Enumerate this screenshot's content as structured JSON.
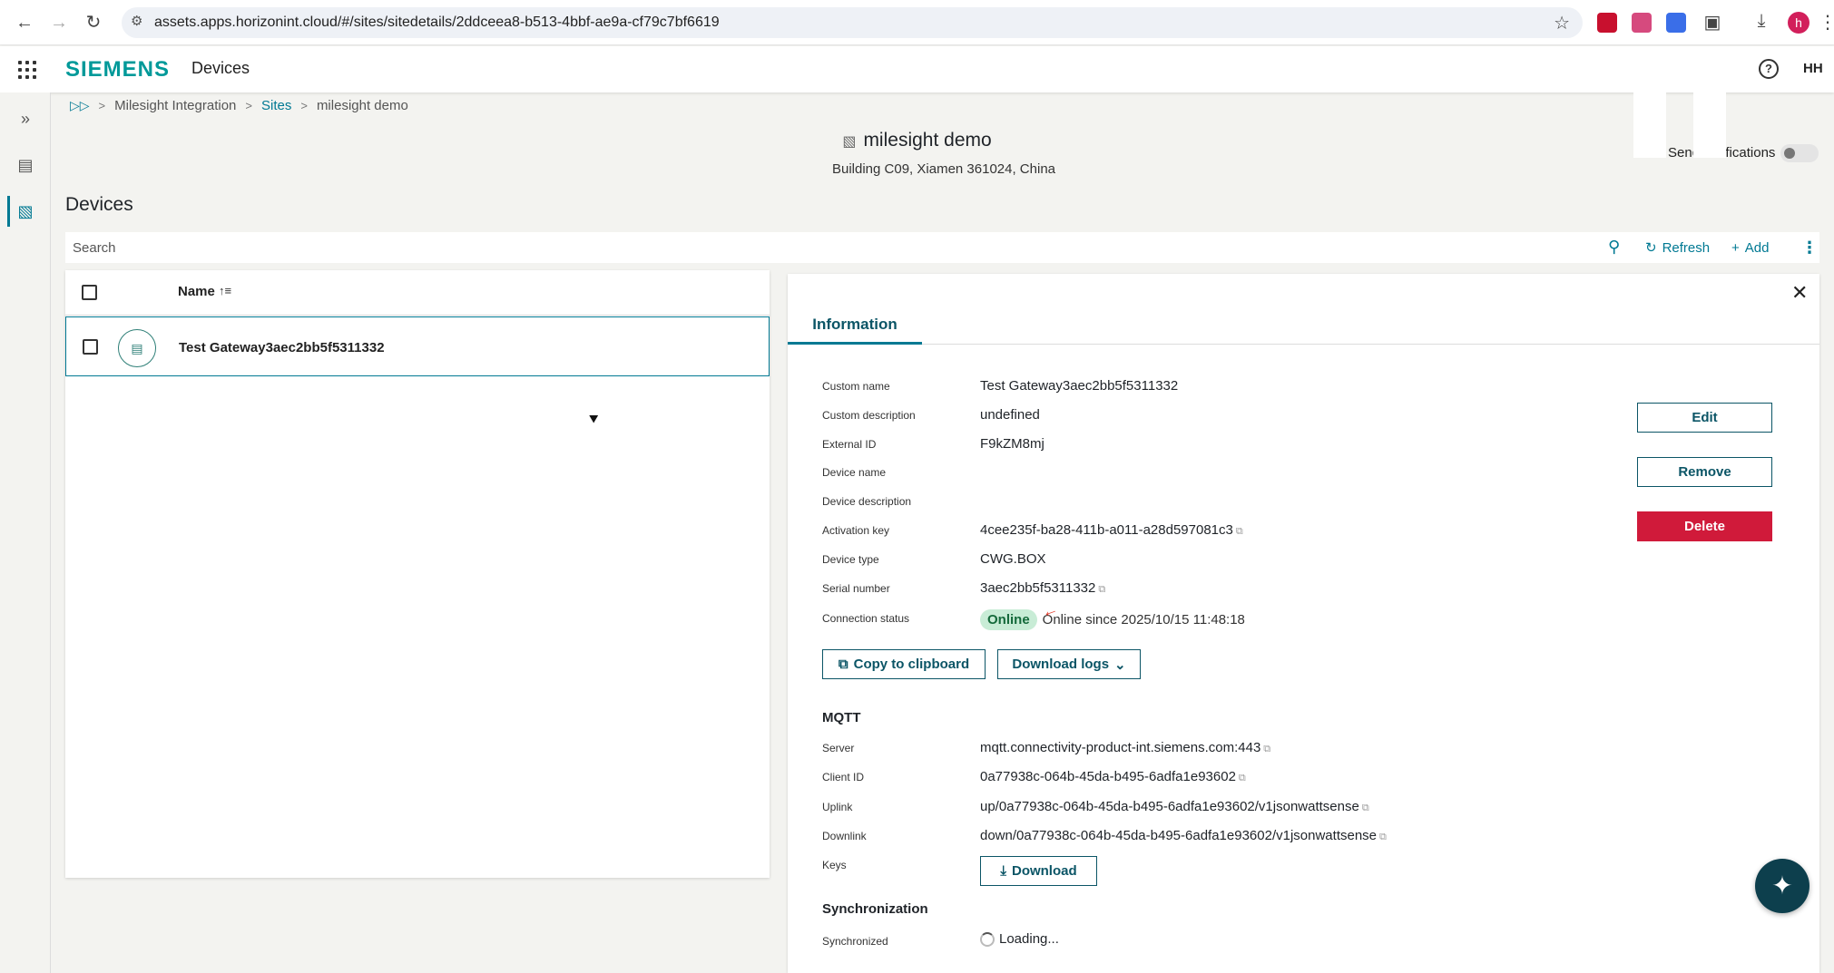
{
  "browser": {
    "url": "assets.apps.horizonint.cloud/#/sites/sitedetails/2ddceea8-b513-4bbf-ae9a-cf79c7bf6619",
    "profile_initial": "h"
  },
  "header": {
    "brand": "SIEMENS",
    "app_title": "Devices",
    "user_initials": "HH",
    "help_glyph": "?"
  },
  "breadcrumb": {
    "items": [
      "Milesight Integration",
      "Sites",
      "milesight demo"
    ]
  },
  "site": {
    "name": "milesight demo",
    "address": "Building C09, Xiamen 361024, China",
    "send_notifications_label": "Send notifications",
    "send_notifications_on": false
  },
  "devices": {
    "heading": "Devices",
    "search_placeholder": "Search",
    "refresh_label": "Refresh",
    "add_label": "Add",
    "column_name": "Name",
    "rows": [
      {
        "name": "Test Gateway3aec2bb5f5311332"
      }
    ]
  },
  "detail": {
    "tab": "Information",
    "fields": {
      "custom_name": {
        "label": "Custom name",
        "value": "Test Gateway3aec2bb5f5311332"
      },
      "custom_description": {
        "label": "Custom description",
        "value": "undefined"
      },
      "external_id": {
        "label": "External ID",
        "value": "F9kZM8mj"
      },
      "device_name": {
        "label": "Device name",
        "value": ""
      },
      "device_description": {
        "label": "Device description",
        "value": ""
      },
      "activation_key": {
        "label": "Activation key",
        "value": "4cee235f-ba28-411b-a011-a28d597081c3"
      },
      "device_type": {
        "label": "Device type",
        "value": "CWG.BOX"
      },
      "serial_number": {
        "label": "Serial number",
        "value": "3aec2bb5f5311332"
      },
      "connection_status": {
        "label": "Connection status",
        "badge": "Online",
        "since": "Online since 2025/10/15 11:48:18"
      }
    },
    "actions": {
      "edit": "Edit",
      "remove": "Remove",
      "delete": "Delete",
      "copy_to_clipboard": "Copy to clipboard",
      "download_logs": "Download logs"
    },
    "mqtt": {
      "title": "MQTT",
      "server": {
        "label": "Server",
        "value": "mqtt.connectivity-product-int.siemens.com:443"
      },
      "client_id": {
        "label": "Client ID",
        "value": "0a77938c-064b-45da-b495-6adfa1e93602"
      },
      "uplink": {
        "label": "Uplink",
        "value": "up/0a77938c-064b-45da-b495-6adfa1e93602/v1jsonwattsense"
      },
      "downlink": {
        "label": "Downlink",
        "value": "down/0a77938c-064b-45da-b495-6adfa1e93602/v1jsonwattsense"
      },
      "keys": {
        "label": "Keys",
        "button": "Download"
      }
    },
    "sync": {
      "title": "Synchronization",
      "label": "Synchronized",
      "value": "Loading..."
    }
  },
  "colors": {
    "brand": "#009999",
    "accent": "#007993",
    "danger": "#d01a3a",
    "online_bg": "#c8ecd6"
  }
}
